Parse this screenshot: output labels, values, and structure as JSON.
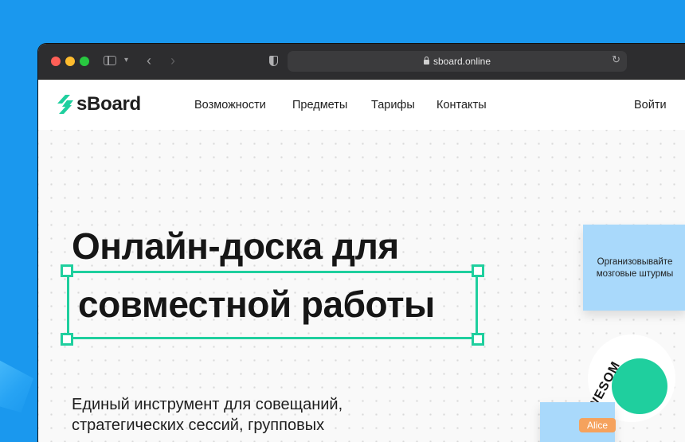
{
  "browser": {
    "url": "sboard.online",
    "icons": [
      "sidebar-toggle-icon",
      "chevron-down-icon",
      "back-arrow-icon",
      "forward-arrow-icon",
      "shield-icon",
      "lock-icon",
      "reload-icon"
    ]
  },
  "nav": {
    "logo_text": "sBoard",
    "links": [
      "Возможности",
      "Предметы",
      "Тарифы",
      "Контакты"
    ],
    "login": "Войти"
  },
  "hero": {
    "title_line1": "Онлайн-доска для",
    "title_line2": "совместной  работы",
    "description_line1": "Единый инструмент для совещаний,",
    "description_line2": "стратегических сессий, групповых"
  },
  "sticky_note": {
    "line1": "Организовывайте",
    "line2": "мозговые штурмы"
  },
  "badge_text": "AWESOM",
  "cursor_name": "Alice",
  "colors": {
    "background": "#1a98ee",
    "accent": "#1fcf9e",
    "sticky": "#a9d9fb",
    "cursor": "#f5a25d"
  }
}
